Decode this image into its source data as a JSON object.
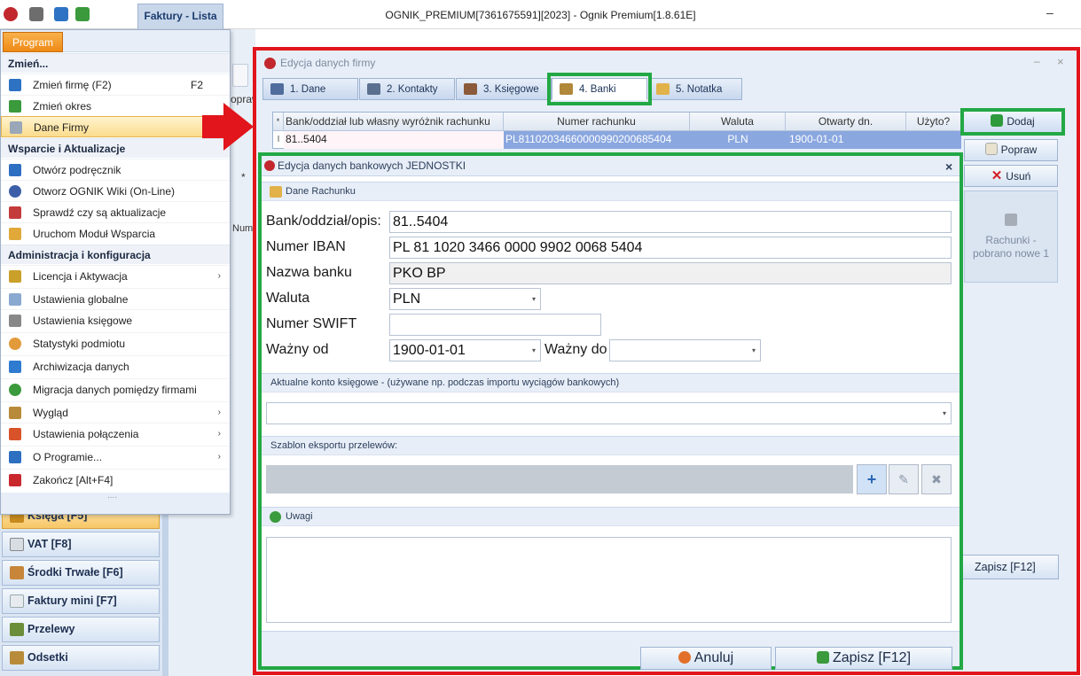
{
  "window": {
    "title": "OGNIK_PREMIUM[7361675591][2023] - Ognik Premium[1.8.61E]",
    "doc_tab": "Faktury - Lista",
    "minimize": "–"
  },
  "menu": {
    "button": "Program",
    "sections": [
      {
        "title": "Zmień...",
        "items": [
          {
            "label": "Zmień firmę (F2)",
            "shortcut": "F2"
          },
          {
            "label": "Zmień okres"
          },
          {
            "label": "Dane Firmy"
          }
        ]
      },
      {
        "title": "Wsparcie i Aktualizacje",
        "items": [
          {
            "label": "Otwórz podręcznik"
          },
          {
            "label": "Otworz OGNIK Wiki (On-Line)"
          },
          {
            "label": "Sprawdź czy są aktualizacje"
          },
          {
            "label": "Uruchom Moduł Wsparcia"
          }
        ]
      },
      {
        "title": "Administracja i konfiguracja",
        "items": [
          {
            "label": "Licencja i Aktywacja"
          },
          {
            "label": "Ustawienia globalne"
          },
          {
            "label": "Ustawienia księgowe"
          },
          {
            "label": "Statystyki podmiotu"
          },
          {
            "label": "Archiwizacja danych"
          },
          {
            "label": "Migracja danych pomiędzy firmami"
          },
          {
            "label": "Wygląd"
          },
          {
            "label": "Ustawienia połączenia"
          },
          {
            "label": "O Programie..."
          },
          {
            "label": "Zakończ [Alt+F4]"
          }
        ]
      }
    ],
    "footer_dots": "....",
    "submenu_arrow": "›"
  },
  "nav": [
    {
      "label": "Księga [F5]",
      "icon": "book-icon"
    },
    {
      "label": "VAT [F8]",
      "icon": "vat-icon"
    },
    {
      "label": "Środki Trwałe [F6]",
      "icon": "assets-icon"
    },
    {
      "label": "Faktury mini [F7]",
      "icon": "invoice-icon"
    },
    {
      "label": "Przelewy",
      "icon": "transfer-icon"
    },
    {
      "label": "Odsetki",
      "icon": "interest-icon"
    }
  ],
  "background_fragments": {
    "popraw": "opraw",
    "asterisk": "*",
    "num": "Num"
  },
  "company_dialog": {
    "title": "Edycja danych firmy",
    "min": "–",
    "close": "×",
    "tabs": [
      {
        "label": "1. Dane"
      },
      {
        "label": "2. Kontakty"
      },
      {
        "label": "3. Księgowe"
      },
      {
        "label": "4. Banki"
      },
      {
        "label": "5. Notatka"
      }
    ],
    "table": {
      "columns": [
        "Bank/oddział lub własny wyróżnik rachunku",
        "Numer rachunku",
        "Waluta",
        "Otwarty dn.",
        "Użyto?"
      ],
      "header_marker": "*",
      "rows": [
        {
          "marker": "I",
          "bank": "81..5404",
          "number": "PL81102034660000990200685404",
          "currency": "PLN",
          "opened": "1900-01-01",
          "used": ""
        }
      ]
    },
    "buttons": {
      "add": "Dodaj",
      "edit": "Popraw",
      "delete": "Usuń",
      "accounts": "Rachunki - pobrano nowe 1",
      "save": "Zapisz [F12]"
    }
  },
  "bank_dialog": {
    "title": "Edycja danych bankowych JEDNOSTKI",
    "close": "×",
    "section_account": "Dane Rachunku",
    "fields": {
      "bank_label": "Bank/oddział/opis:",
      "bank_value": "81..5404",
      "iban_label": "Numer IBAN",
      "iban_value": "PL 81 1020 3466 0000 9902 0068 5404",
      "name_label": "Nazwa banku",
      "name_value": "PKO BP",
      "currency_label": "Waluta",
      "currency_value": "PLN",
      "swift_label": "Numer SWIFT",
      "swift_value": "",
      "valid_from_label": "Ważny od",
      "valid_from_value": "1900-01-01",
      "valid_to_label": "Ważny do",
      "valid_to_value": ""
    },
    "section_konto": "Aktualne konto księgowe - (używane np. podczas importu wyciągów bankowych)",
    "section_template": "Szablon eksportu przelewów:",
    "section_notes": "Uwagi",
    "dropdown_arrow": "▾",
    "template_buttons": {
      "add": "+",
      "edit": "✎",
      "delete": "✖"
    },
    "cancel": "Anuluj",
    "save": "Zapisz [F12]"
  }
}
